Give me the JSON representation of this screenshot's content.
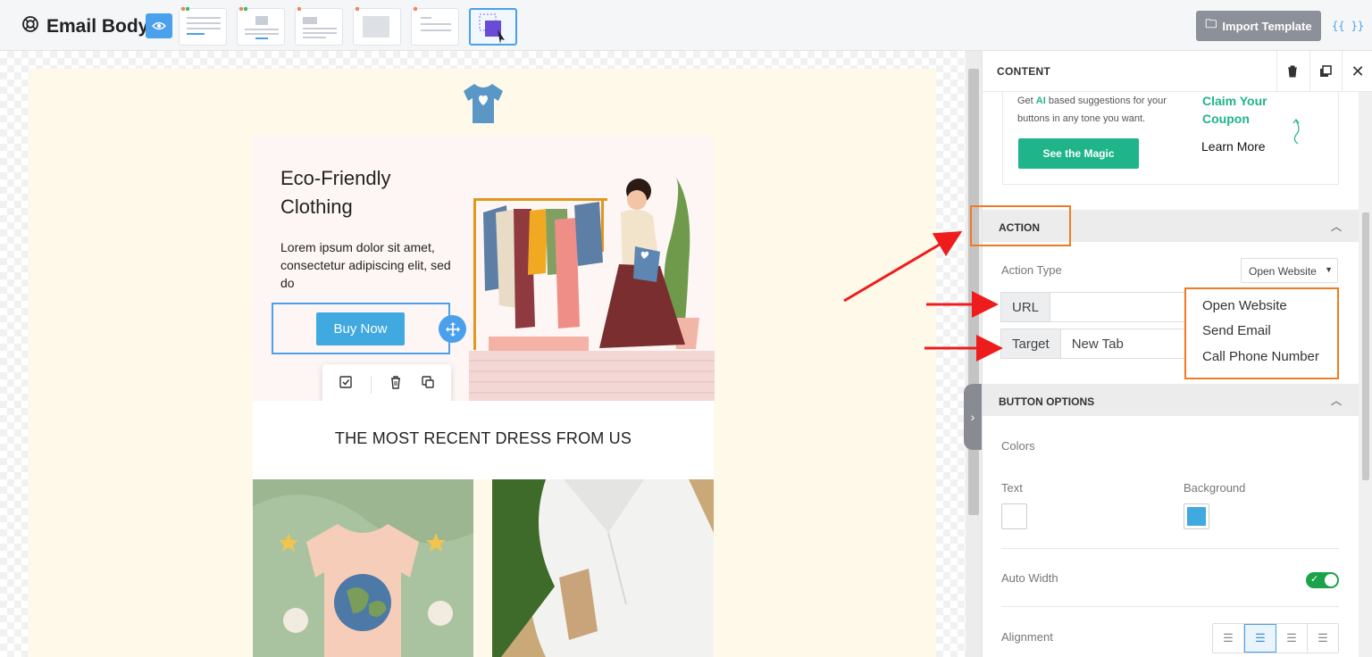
{
  "topbar": {
    "title": "Email Body",
    "import_label": "Import Template",
    "braces_label": "{{ }}"
  },
  "email": {
    "hero_title": "Eco-Friendly Clothing",
    "hero_body": "Lorem ipsum dolor sit amet, consectetur adipiscing elit, sed do",
    "button_label": "Buy Now",
    "section_heading": "THE MOST RECENT DRESS FROM US"
  },
  "panel": {
    "header": "CONTENT",
    "ai": {
      "text_prefix": "Get ",
      "text_highlight": "AI",
      "text_suffix": " based suggestions for your buttons in any tone you want.",
      "magic_button": "See the Magic",
      "claim_text": "Claim Your Coupon",
      "learn_more": "Learn More"
    },
    "action": {
      "section_label": "ACTION",
      "action_type_label": "Action Type",
      "action_type_value": "Open Website",
      "url_label": "URL",
      "url_value": "",
      "target_label": "Target",
      "target_value": "New Tab",
      "options": [
        "Open Website",
        "Send Email",
        "Call Phone Number"
      ]
    },
    "button_options": {
      "section_label": "BUTTON OPTIONS",
      "colors_label": "Colors",
      "text_label": "Text",
      "background_label": "Background",
      "text_color": "#ffffff",
      "background_color": "#3fa9e0",
      "auto_width_label": "Auto Width",
      "auto_width_on": true,
      "alignment_label": "Alignment",
      "alignment_value": "center"
    }
  },
  "colors": {
    "accent": "#4aa0ea",
    "highlight": "#f07a22",
    "arrow": "#ee1c1c",
    "magic": "#1fb489"
  }
}
